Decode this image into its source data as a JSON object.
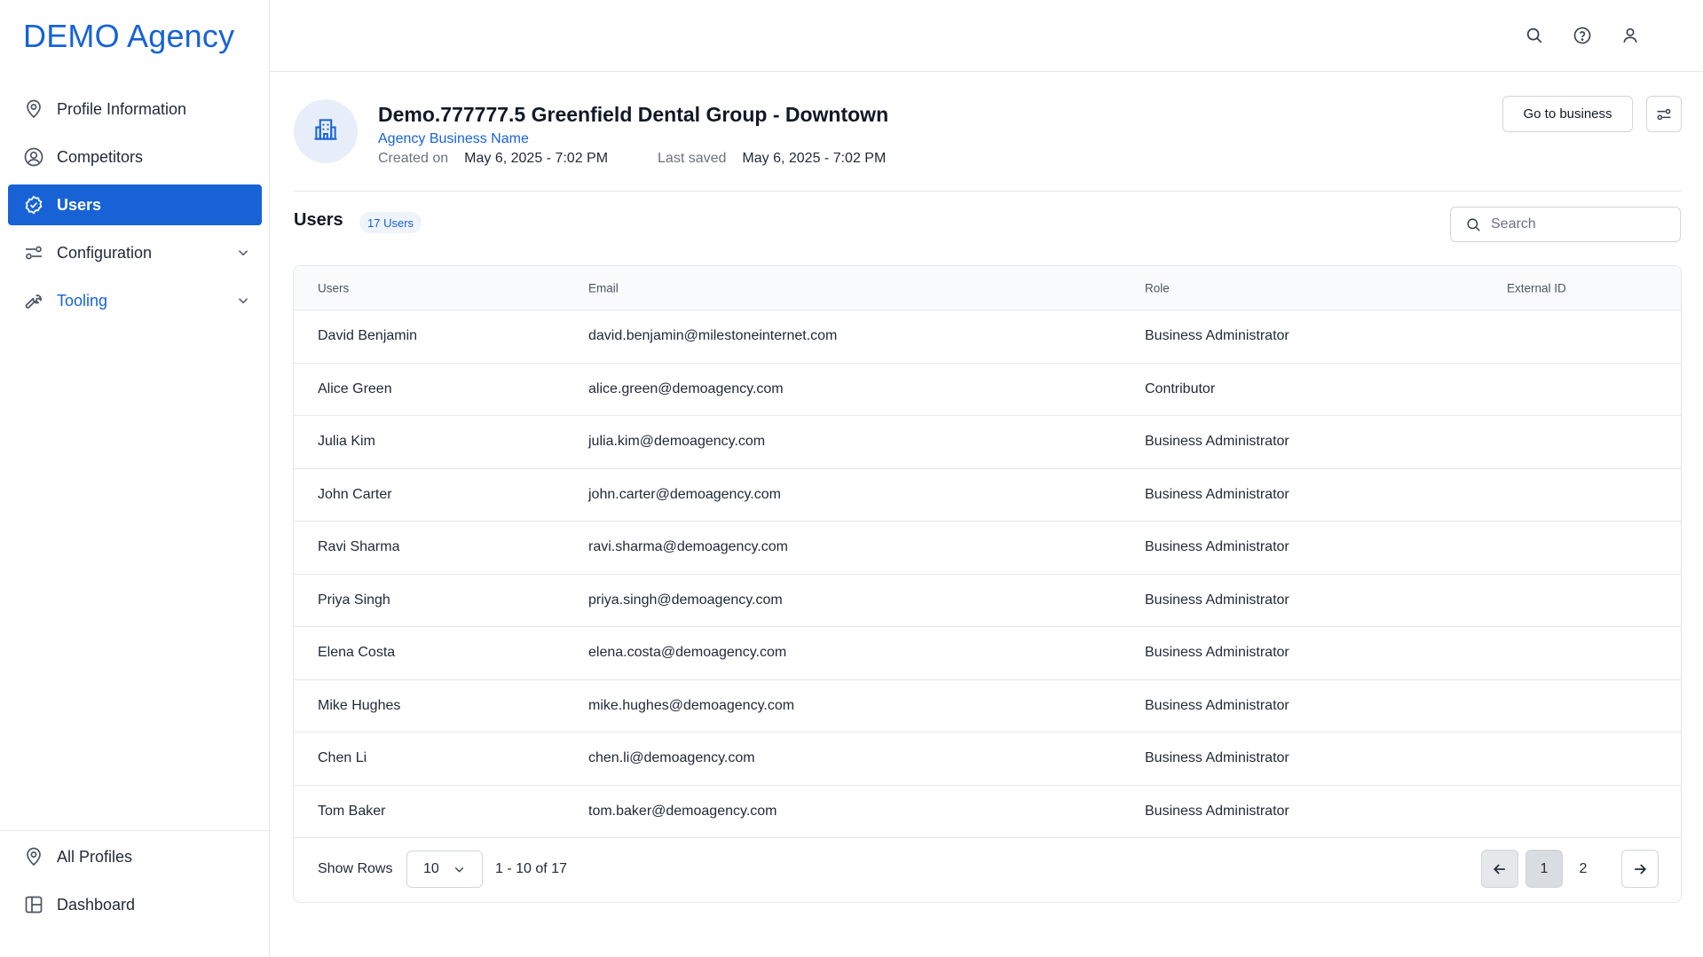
{
  "app": {
    "logo": "DEMO Agency"
  },
  "sidebar": {
    "items": [
      {
        "label": "Profile Information",
        "icon": "map-pin-icon"
      },
      {
        "label": "Competitors",
        "icon": "user-circle-icon"
      },
      {
        "label": "Users",
        "icon": "check-circle-icon",
        "active": true
      },
      {
        "label": "Configuration",
        "icon": "sliders-icon"
      },
      {
        "label": "Tooling",
        "icon": "wrench-icon"
      }
    ],
    "bottom": [
      {
        "label": "All Profiles",
        "icon": "map-pin-icon"
      },
      {
        "label": "Dashboard",
        "icon": "layout-icon"
      }
    ]
  },
  "header": {
    "title": "Demo.777777.5 Greenfield Dental Group - Downtown",
    "subtitle": "Agency Business Name",
    "created_label": "Created on",
    "created_value": "May 6, 2025 - 7:02 PM",
    "saved_label": "Last saved",
    "saved_value": "May 6, 2025 - 7:02 PM",
    "go_button": "Go to business"
  },
  "users_section": {
    "title": "Users",
    "count": "17 Users",
    "search_placeholder": "Search"
  },
  "table": {
    "columns": [
      "Users",
      "Email",
      "Role",
      "External ID"
    ],
    "rows": [
      {
        "name": "David Benjamin",
        "email": "david.benjamin@milestoneinternet.com",
        "role": "Business Administrator",
        "external_id": ""
      },
      {
        "name": "Alice Green",
        "email": "alice.green@demoagency.com",
        "role": "Contributor",
        "external_id": ""
      },
      {
        "name": "Julia Kim",
        "email": "julia.kim@demoagency.com",
        "role": "Business Administrator",
        "external_id": ""
      },
      {
        "name": "John Carter",
        "email": "john.carter@demoagency.com",
        "role": "Business Administrator",
        "external_id": ""
      },
      {
        "name": "Ravi Sharma",
        "email": "ravi.sharma@demoagency.com",
        "role": "Business Administrator",
        "external_id": ""
      },
      {
        "name": "Priya Singh",
        "email": "priya.singh@demoagency.com",
        "role": "Business Administrator",
        "external_id": ""
      },
      {
        "name": "Elena Costa",
        "email": "elena.costa@demoagency.com",
        "role": "Business Administrator",
        "external_id": ""
      },
      {
        "name": "Mike Hughes",
        "email": "mike.hughes@demoagency.com",
        "role": "Business Administrator",
        "external_id": ""
      },
      {
        "name": "Chen Li",
        "email": "chen.li@demoagency.com",
        "role": "Business Administrator",
        "external_id": ""
      },
      {
        "name": "Tom Baker",
        "email": "tom.baker@demoagency.com",
        "role": "Business Administrator",
        "external_id": ""
      }
    ]
  },
  "footer": {
    "show_rows_label": "Show Rows",
    "rows_value": "10",
    "range": "1 - 10 of 17",
    "pages": [
      "1",
      "2"
    ],
    "current_page": "1"
  },
  "colors": {
    "accent": "#1763d6",
    "border": "#e5e7eb"
  }
}
